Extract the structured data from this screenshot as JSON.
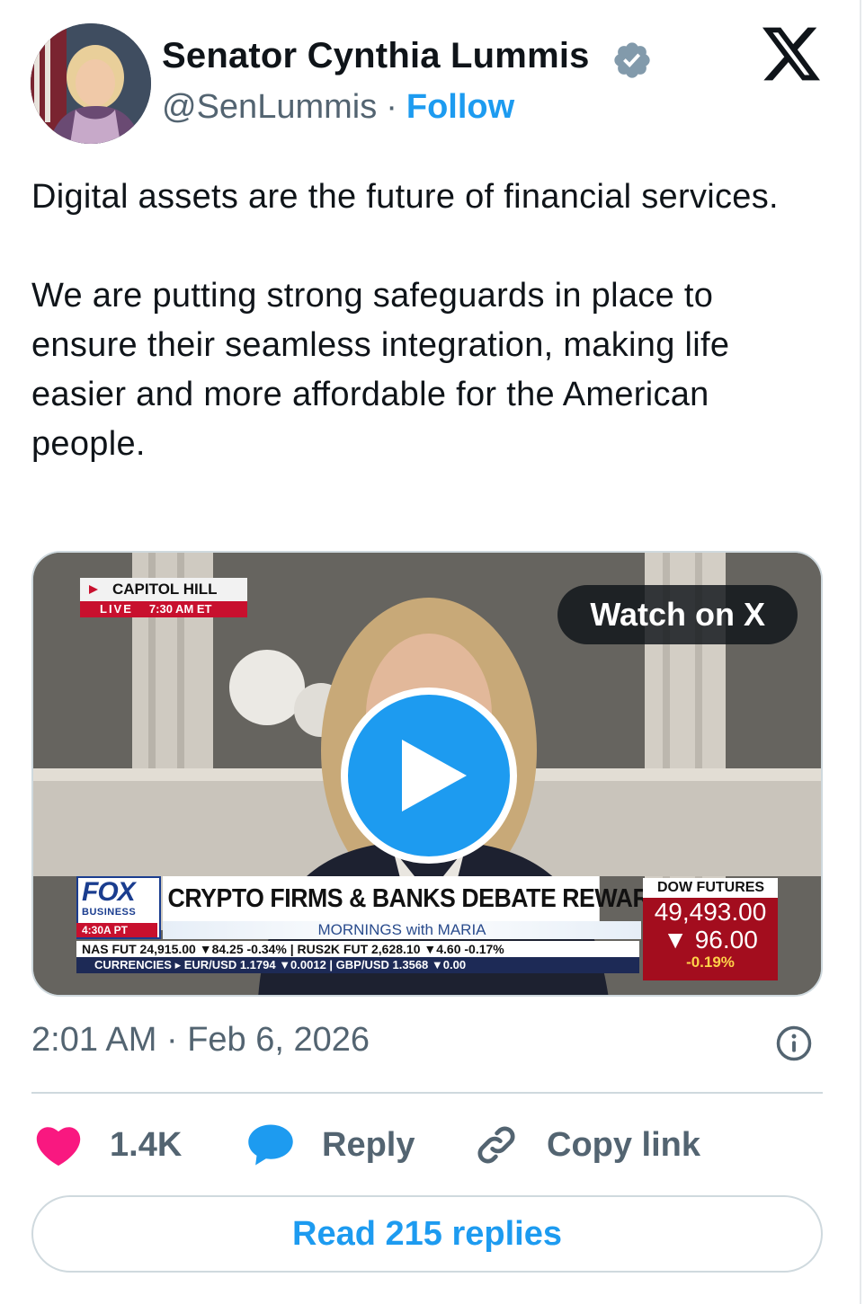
{
  "author": {
    "name": "Senator Cynthia Lummis",
    "handle": "@SenLummis",
    "separator": "·",
    "follow_label": "Follow",
    "verified_icon": "verified-badge-icon"
  },
  "tweet": {
    "paragraph_1": "Digital assets are the future of financial services.",
    "paragraph_2": "We are putting strong safeguards in place to ensure their seamless integration, making life easier and more affordable for the American people."
  },
  "media": {
    "watch_label": "Watch on X",
    "location_bug": "CAPITOL HILL",
    "live_label": "LIVE",
    "live_time": "7:30 AM ET",
    "network_logo": "FOX",
    "network_sub": "BUSINESS",
    "local_time": "4:30A PT",
    "headline": "CRYPTO FIRMS & BANKS DEBATE REWARDS",
    "show_name": "MORNINGS with MARIA",
    "ticker_1": "NAS FUT  24,915.00 ▼84.25  -0.34% | RUS2K FUT  2,628.10 ▼4.60  -0.17%",
    "ticker_2": "CURRENCIES ▸ EUR/USD 1.1794 ▼0.0012 | GBP/USD 1.3568 ▼0.00",
    "dow_label": "DOW FUTURES",
    "dow_value": "49,493.00",
    "dow_change": "▼ 96.00",
    "dow_pct": "-0.19%"
  },
  "timestamp": "2:01 AM · Feb 6, 2026",
  "actions": {
    "likes": "1.4K",
    "reply_label": "Reply",
    "copy_label": "Copy link"
  },
  "read_replies_label": "Read 215 replies",
  "colors": {
    "accent": "#1d9bf0",
    "like": "#f91880",
    "muted_text": "#536471",
    "text": "#0f1419"
  }
}
